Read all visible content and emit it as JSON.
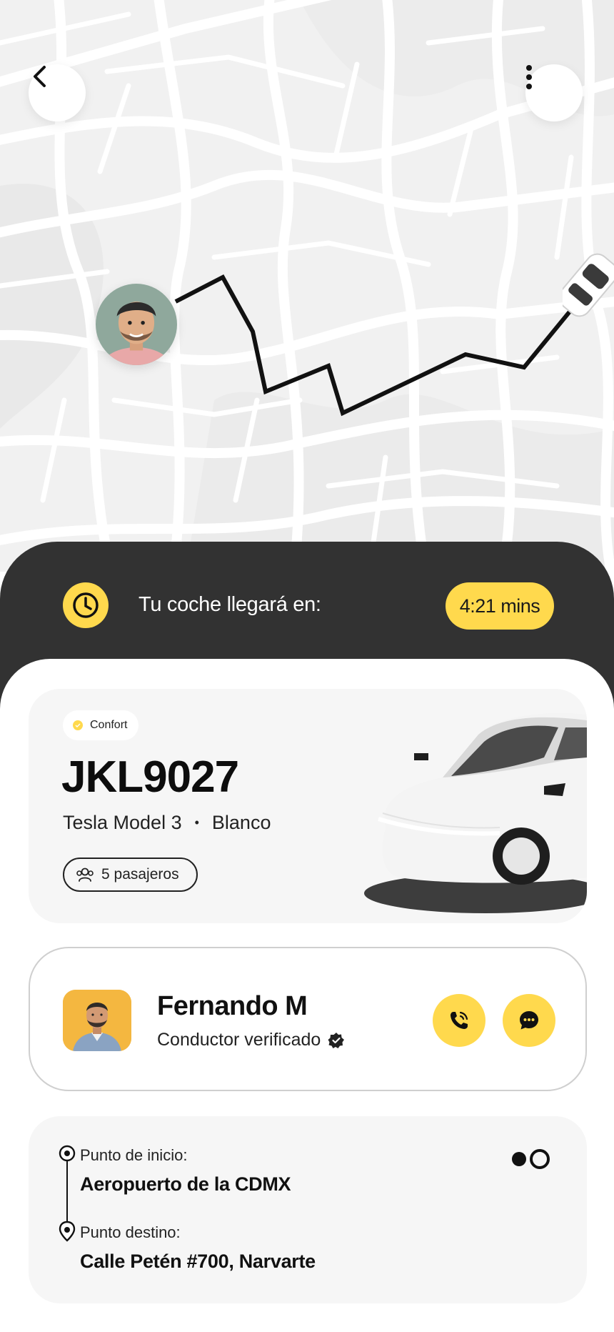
{
  "map": {
    "icons": {
      "back": "chevron-left-icon",
      "more": "more-vertical-icon",
      "car": "car-top-view-icon"
    },
    "colors": {
      "route": "#111111",
      "roads": "#ffffff",
      "ground": "#f2f2f2"
    }
  },
  "eta": {
    "label": "Tu coche llegará en:",
    "time": "4:21 mins",
    "icon": "clock-icon",
    "colors": {
      "panel": "#323232",
      "accent": "#ffd94d"
    }
  },
  "vehicle": {
    "tier": "Confort",
    "plate": "JKL9027",
    "model": "Tesla Model 3",
    "separator": "•",
    "color": "Blanco",
    "passengers": "5 pasajeros",
    "passengers_icon": "users-icon"
  },
  "driver": {
    "name": "Fernando M",
    "status": "Conductor verificado",
    "verified_icon": "verified-badge-icon",
    "call_icon": "phone-icon",
    "chat_icon": "chat-bubble-icon"
  },
  "route": {
    "start_label": "Punto de inicio:",
    "start_value": "Aeropuerto de la CDMX",
    "dest_label": "Punto destino:",
    "dest_value": "Calle Petén #700, Narvarte",
    "swap_icon": "route-toggle-icon"
  }
}
